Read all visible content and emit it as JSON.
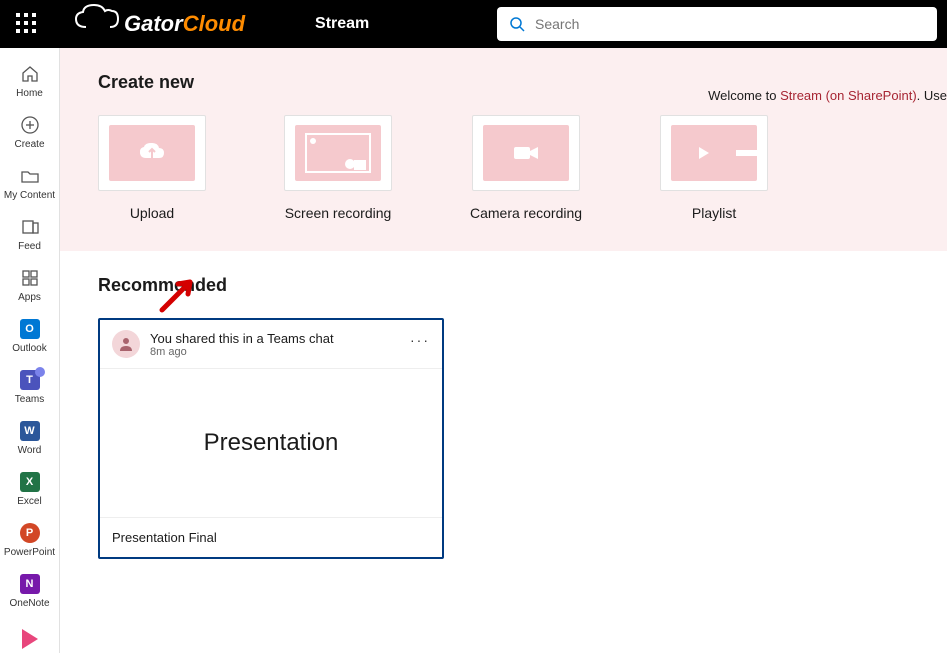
{
  "header": {
    "logo_part1": "Gator",
    "logo_part2": "Cloud",
    "app_title": "Stream",
    "search_placeholder": "Search"
  },
  "left_rail": {
    "items": [
      {
        "label": "Home"
      },
      {
        "label": "Create"
      },
      {
        "label": "My Content"
      },
      {
        "label": "Feed"
      },
      {
        "label": "Apps"
      },
      {
        "label": "Outlook",
        "letter": "O"
      },
      {
        "label": "Teams",
        "letter": "T"
      },
      {
        "label": "Word",
        "letter": "W"
      },
      {
        "label": "Excel",
        "letter": "X"
      },
      {
        "label": "PowerPoint",
        "letter": "P"
      },
      {
        "label": "OneNote",
        "letter": "N"
      }
    ]
  },
  "create_section": {
    "title": "Create new",
    "welcome_prefix": "Welcome to ",
    "welcome_link": "Stream (on SharePoint)",
    "welcome_suffix": ". Use ",
    "cards": [
      {
        "label": "Upload"
      },
      {
        "label": "Screen recording"
      },
      {
        "label": "Camera recording"
      },
      {
        "label": "Playlist"
      }
    ]
  },
  "recommended_section": {
    "title": "Recommended",
    "card": {
      "action_text": "You shared this in a Teams chat",
      "time_text": "8m ago",
      "preview_text": "Presentation",
      "title": "Presentation Final"
    }
  }
}
